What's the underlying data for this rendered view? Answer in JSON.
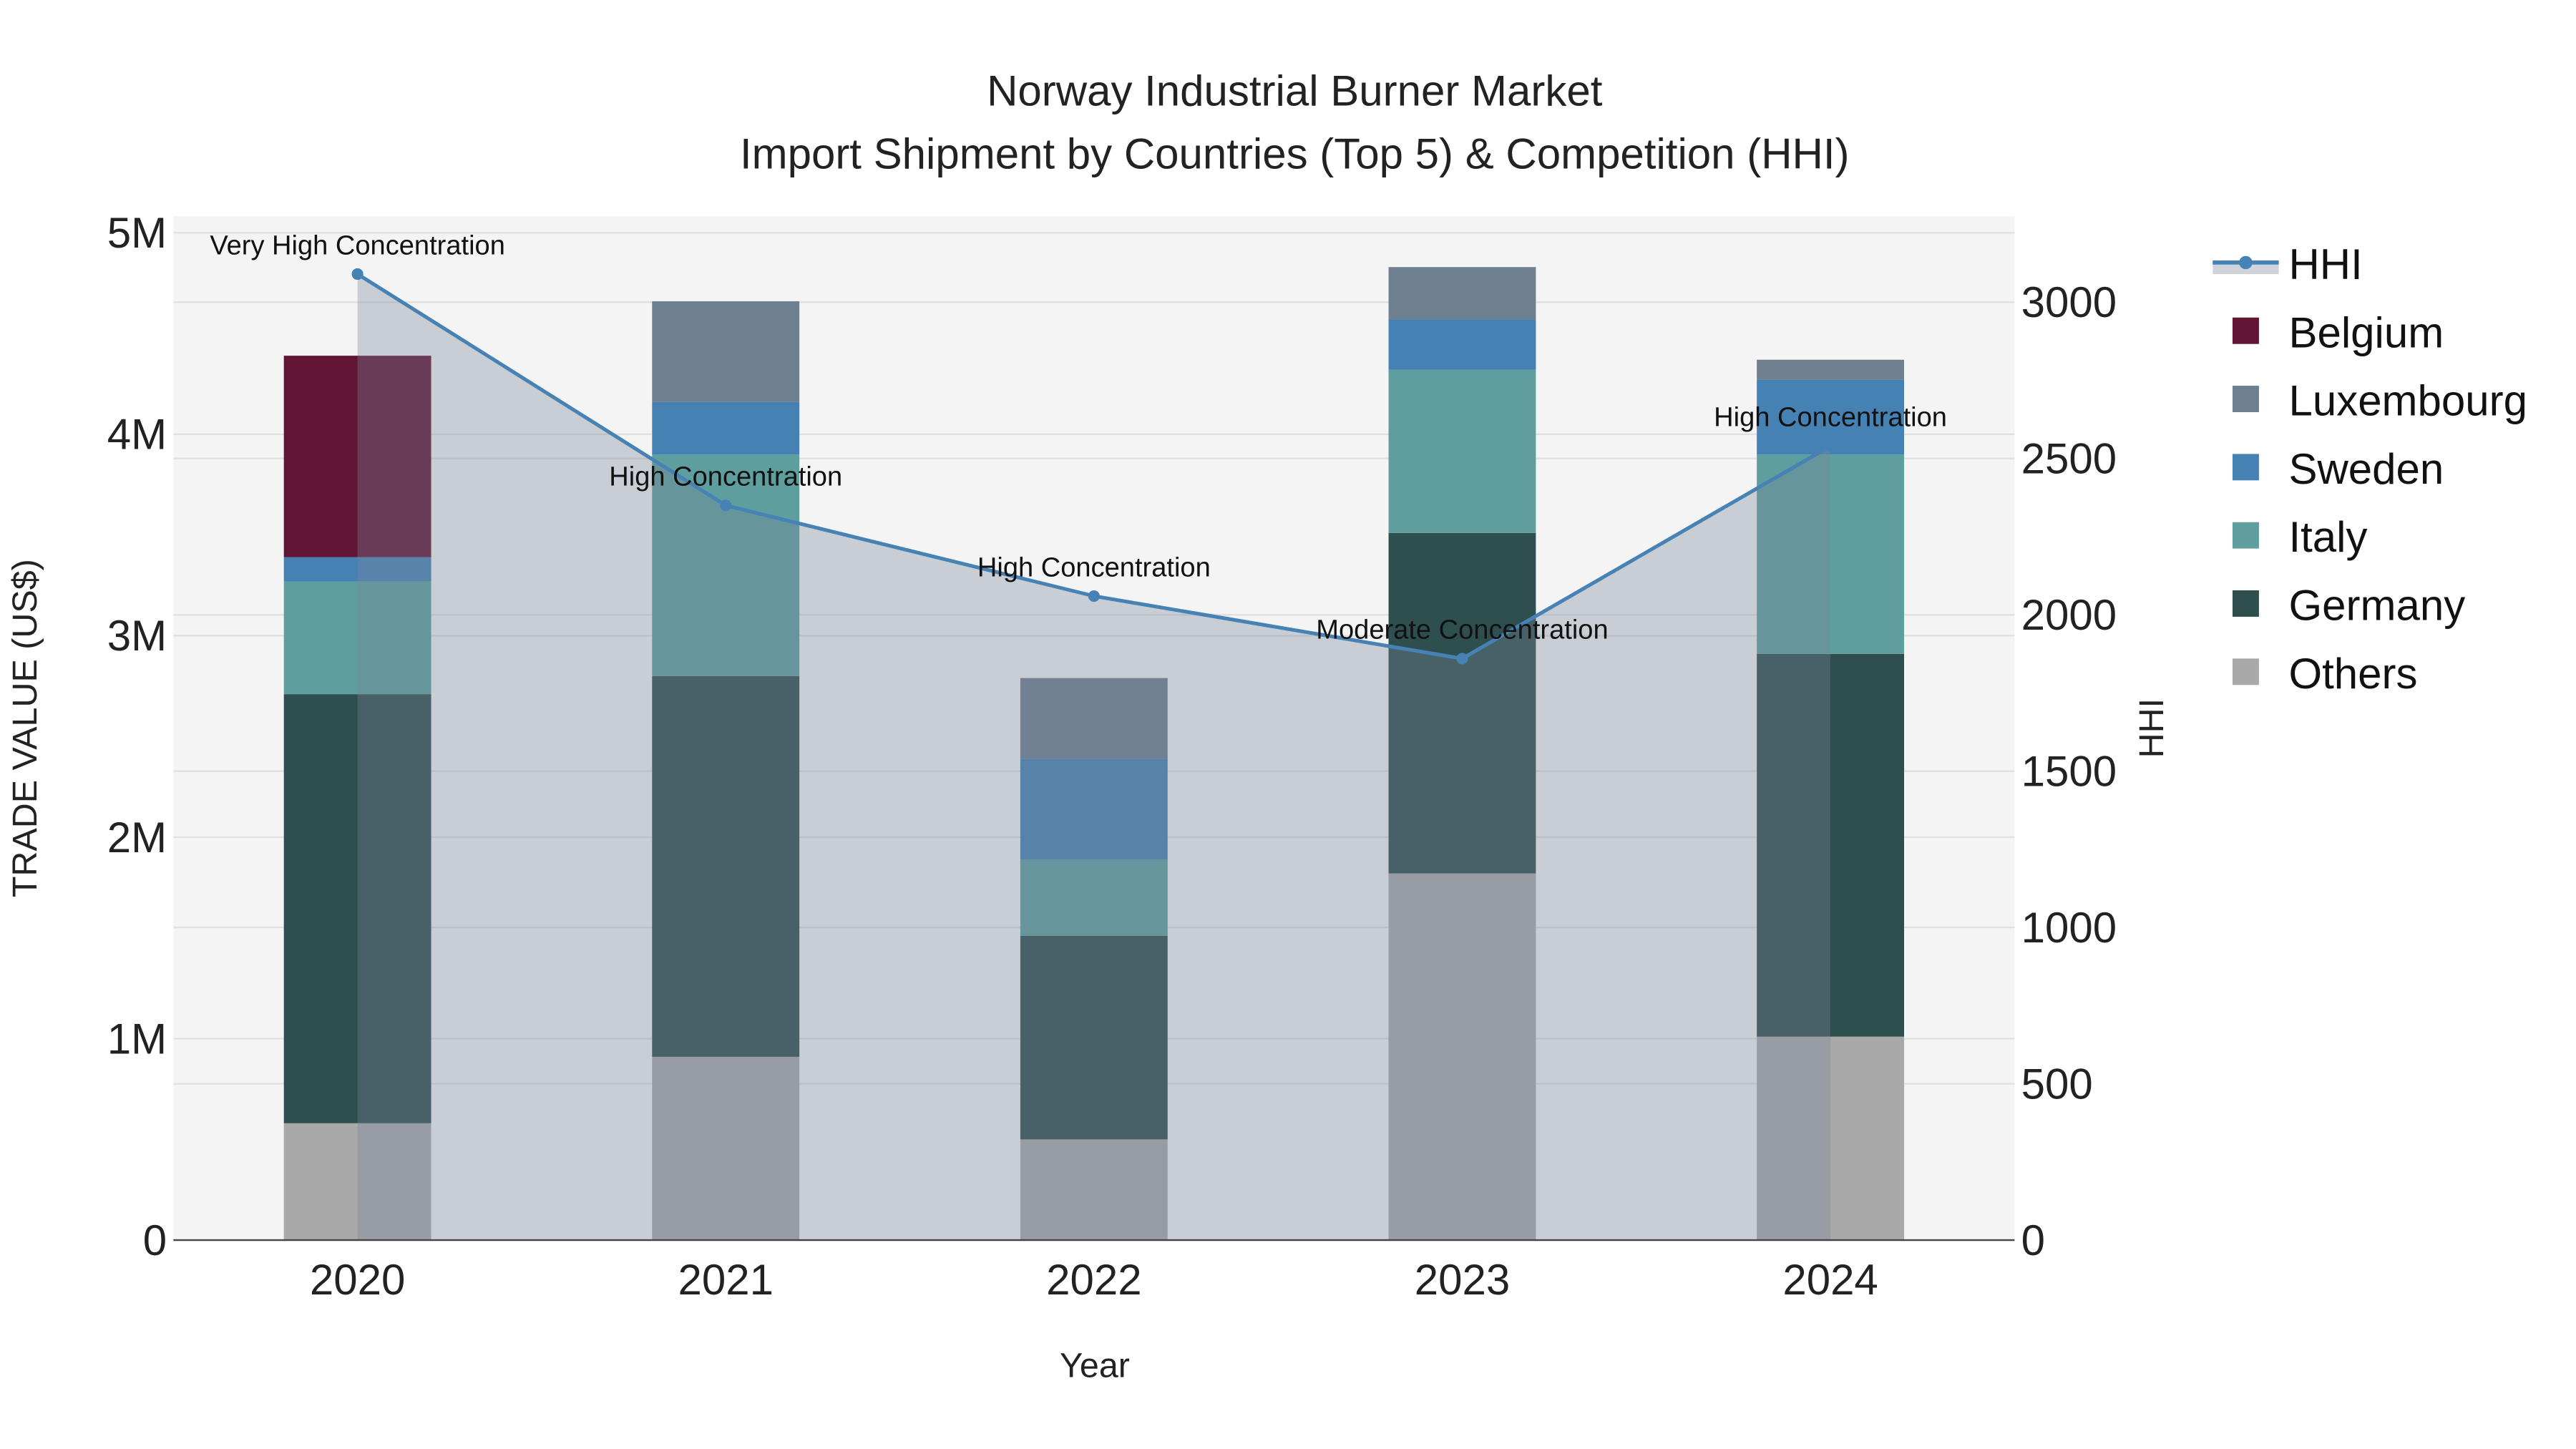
{
  "chart_data": {
    "type": "bar",
    "stacked": true,
    "title": "Norway Industrial Burner Market",
    "subtitle": "Import Shipment by Countries (Top 5) & Competition (HHI)",
    "xlabel": "Year",
    "ylabel": "TRADE VALUE (US$)",
    "y2label": "HHI",
    "categories": [
      "2020",
      "2021",
      "2022",
      "2023",
      "2024"
    ],
    "ylim": [
      0,
      5000000
    ],
    "y_ticks": [
      0,
      1000000,
      2000000,
      3000000,
      4000000,
      5000000
    ],
    "y_tick_labels": [
      "0",
      "1M",
      "2M",
      "3M",
      "4M",
      "5M"
    ],
    "y2lim": [
      0,
      3275
    ],
    "y2_ticks": [
      0,
      500,
      1000,
      1500,
      2000,
      2500,
      3000
    ],
    "y2_tick_labels": [
      "0",
      "500",
      "1000",
      "1500",
      "2000",
      "2500",
      "3000"
    ],
    "series": [
      {
        "name": "Others",
        "color": "#a9a9a9",
        "values": [
          580000,
          910000,
          500000,
          1820000,
          1010000
        ]
      },
      {
        "name": "Germany",
        "color": "#2f4f4f",
        "values": [
          2130000,
          1890000,
          1010000,
          1690000,
          1900000
        ]
      },
      {
        "name": "Italy",
        "color": "#5f9e9e",
        "values": [
          560000,
          1100000,
          380000,
          810000,
          990000
        ]
      },
      {
        "name": "Sweden",
        "color": "#4681b4",
        "values": [
          120000,
          260000,
          500000,
          250000,
          370000
        ]
      },
      {
        "name": "Luxembourg",
        "color": "#6e7f8f",
        "values": [
          0,
          500000,
          400000,
          260000,
          100000
        ]
      },
      {
        "name": "Belgium",
        "color": "#611434",
        "values": [
          1000000,
          0,
          0,
          0,
          0
        ]
      }
    ],
    "hhi": {
      "name": "HHI",
      "color": "#4682b4",
      "values": [
        3090,
        2350,
        2060,
        1860,
        2540
      ],
      "annotations": [
        "Very High Concentration",
        "High Concentration",
        "High Concentration",
        "Moderate Concentration",
        "High Concentration"
      ]
    },
    "legend": {
      "placement": "right",
      "entries": [
        "HHI",
        "Belgium",
        "Luxembourg",
        "Sweden",
        "Italy",
        "Germany",
        "Others"
      ]
    },
    "grid": true
  }
}
